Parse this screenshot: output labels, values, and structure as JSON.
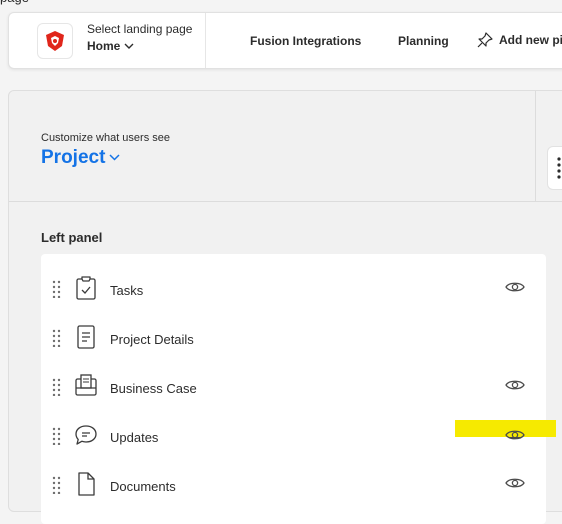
{
  "nav": {
    "select_label": "Select landing page",
    "select_value": "Home",
    "links": [
      "Fusion Integrations",
      "Planning"
    ],
    "add_pin": "Add new pin"
  },
  "panel": {
    "customize_label": "Customize what users see",
    "object_type": "Project",
    "section_title": "Left panel",
    "items": [
      {
        "label": "Tasks",
        "icon": "clipboard-check-icon",
        "visible_toggle": true
      },
      {
        "label": "Project Details",
        "icon": "document-lines-icon",
        "visible_toggle": false
      },
      {
        "label": "Business Case",
        "icon": "briefcase-doc-icon",
        "visible_toggle": true
      },
      {
        "label": "Updates",
        "icon": "speech-bubble-icon",
        "visible_toggle": true
      },
      {
        "label": "Documents",
        "icon": "file-icon",
        "visible_toggle": true
      }
    ]
  },
  "colors": {
    "accent": "#1473e6",
    "highlight": "#f6ea00"
  }
}
